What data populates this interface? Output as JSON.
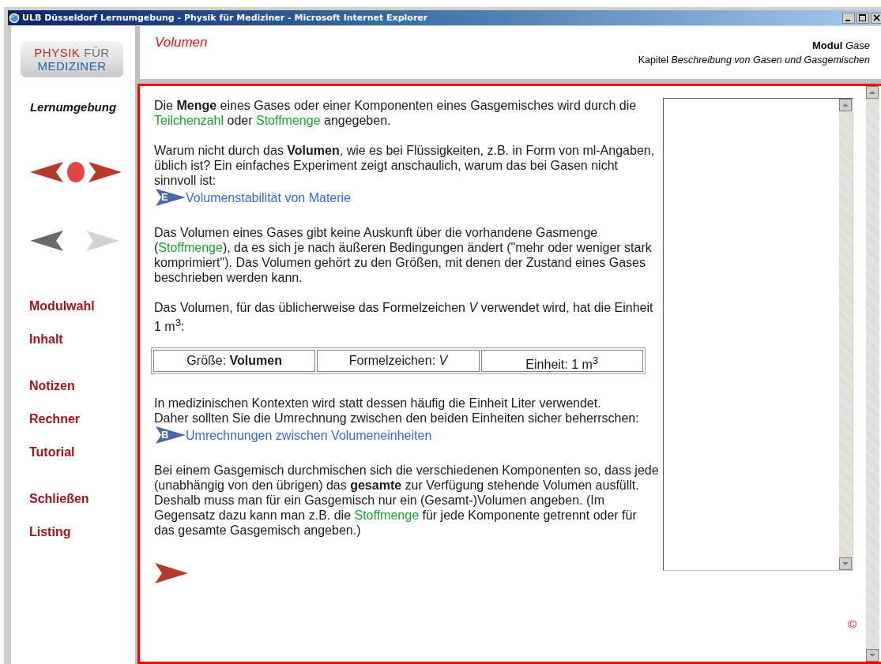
{
  "window": {
    "title": "ULB Düsseldorf Lernumgebung - Physik für Mediziner - Microsoft Internet Explorer"
  },
  "sidebar": {
    "logo": {
      "lines": [
        {
          "words": [
            {
              "text": "PHYSIK",
              "color": "#c0282d"
            },
            {
              "text": "FÜR",
              "color": "#6e6e6e"
            }
          ]
        },
        {
          "words": [
            {
              "text": "MEDIZINER",
              "color": "#1e64a8"
            }
          ]
        }
      ]
    },
    "subtitle": "Lernumgebung",
    "nav_main": [
      {
        "kind": "back"
      },
      {
        "kind": "home"
      },
      {
        "kind": "forward"
      }
    ],
    "nav_history": [
      {
        "kind": "back",
        "disabled": false
      },
      {
        "kind": "forward",
        "disabled": true
      }
    ],
    "menu_groups": [
      [
        "Modulwahl",
        "Inhalt"
      ],
      [
        "Notizen",
        "Rechner",
        "Tutorial"
      ],
      [
        "Schließen",
        "Listing"
      ]
    ]
  },
  "header": {
    "title": "Volumen",
    "module": "**Modul** *Gase*",
    "chapter": "Kapitel *Beschreibung von Gasen und Gasgemischen*"
  },
  "content": {
    "blocks": [
      {
        "kind": "paragraph",
        "parts": [
          {
            "kind": "text",
            "text": "Die **Menge** eines Gases oder einer Komponenten eines Gasgemisches wird durch die "
          },
          {
            "kind": "term",
            "text": "Teilchenzahl"
          },
          {
            "kind": "text",
            "text": " oder "
          },
          {
            "kind": "term",
            "text": "Stoffmenge"
          },
          {
            "kind": "text",
            "text": " angegeben."
          }
        ]
      },
      {
        "kind": "paragraph",
        "parts": [
          {
            "kind": "text",
            "text": "Warum nicht durch das **Volumen**, wie es bei Flüssigkeiten, z.B. in Form von ml-Angaben, üblich ist? Ein einfaches Experiment zeigt anschaulich, warum das bei Gasen nicht sinnvoll ist:"
          }
        ]
      },
      {
        "kind": "link",
        "badge": "E",
        "text": "Volumenstabilität von Materie"
      },
      {
        "kind": "paragraph",
        "parts": [
          {
            "kind": "text",
            "text": "Das Volumen eines Gases gibt keine Auskunft über die vorhandene Gasmenge ("
          },
          {
            "kind": "term",
            "text": "Stoffmenge"
          },
          {
            "kind": "text",
            "text": "), da es sich je nach äußeren Bedingungen ändert (\"mehr oder weniger stark komprimiert\"). Das Volumen gehört zu den Größen, mit denen der Zustand eines Gases beschrieben werden kann."
          }
        ]
      },
      {
        "kind": "paragraph",
        "parts": [
          {
            "kind": "text",
            "text": "Das Volumen, für das üblicherweise das Formelzeichen *V* verwendet wird, hat die Einheit 1 m$^{3}$:"
          }
        ]
      },
      {
        "kind": "table",
        "cells": [
          "Größe: **Volumen**",
          "Formelzeichen: *V*",
          "Einheit: 1 m$^{3}$"
        ]
      },
      {
        "kind": "paragraph",
        "parts": [
          {
            "kind": "text",
            "text": "In medizinischen Kontexten wird statt dessen häufig die Einheit Liter verwendet.\nDaher sollten Sie die Umrechnung zwischen den beiden Einheiten sicher beherrschen:"
          }
        ]
      },
      {
        "kind": "link",
        "badge": "B",
        "text": "Umrechnungen zwischen Volumeneinheiten"
      },
      {
        "kind": "paragraph",
        "parts": [
          {
            "kind": "text",
            "text": "Bei einem Gasgemisch durchmischen sich die verschiedenen Komponenten so, dass jede (unabhängig von den übrigen) das **gesamte** zur Verfügung stehende Volumen ausfüllt. Deshalb muss man für ein Gasgemisch nur ein (Gesamt-)Volumen angeben. (Im Gegensatz dazu kann man z.B. die "
          },
          {
            "kind": "term",
            "text": "Stoffmenge"
          },
          {
            "kind": "text",
            "text": " für jede Komponente getrennt oder für das gesamte Gasgemisch angeben.)"
          }
        ]
      }
    ]
  },
  "copyright": "©"
}
